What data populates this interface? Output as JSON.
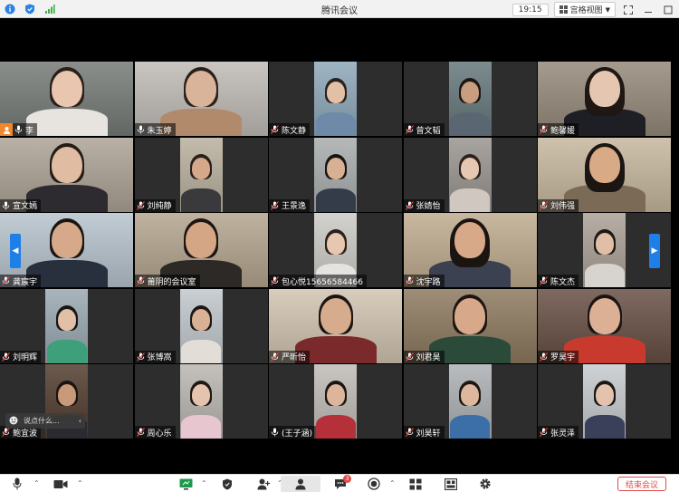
{
  "window": {
    "title": "腾讯会议",
    "time": "19:15",
    "view_mode": "宫格视图"
  },
  "participants": [
    {
      "name": "李",
      "muted": false,
      "host": true
    },
    {
      "name": "朱玉婷",
      "muted": false
    },
    {
      "name": "陈文静",
      "muted": true
    },
    {
      "name": "曾文韬",
      "muted": true
    },
    {
      "name": "鲍馨媛",
      "muted": true
    },
    {
      "name": "宣文嫣",
      "muted": false
    },
    {
      "name": "刘纯静",
      "muted": true
    },
    {
      "name": "王景逸",
      "muted": true
    },
    {
      "name": "张婧怡",
      "muted": true
    },
    {
      "name": "刘伟强",
      "muted": true
    },
    {
      "name": "龚宸宇",
      "muted": true
    },
    {
      "name": "莆阴的会议室",
      "muted": true
    },
    {
      "name": "包心悦15656584466",
      "muted": true
    },
    {
      "name": "沈宇路",
      "muted": true
    },
    {
      "name": "陈文杰",
      "muted": true
    },
    {
      "name": "刘明辉",
      "muted": true
    },
    {
      "name": "张博嵩",
      "muted": true
    },
    {
      "name": "严昕怡",
      "muted": true
    },
    {
      "name": "刘君昊",
      "muted": true
    },
    {
      "name": "罗昊宇",
      "muted": true
    },
    {
      "name": "鲍宜波",
      "muted": true
    },
    {
      "name": "周心乐",
      "muted": true
    },
    {
      "name": "(王子涵)",
      "muted": false
    },
    {
      "name": "刘昊轩",
      "muted": true
    },
    {
      "name": "张灵泽",
      "muted": true
    }
  ],
  "chat_popup": {
    "placeholder": "说点什么..."
  },
  "toolbar": {
    "end_label": "结束会议",
    "chat_badge": "3"
  },
  "colors": {
    "accent": "#1f7fe8",
    "end": "#e04848",
    "active_speaker": "#4c9a2a",
    "host": "#f0872d"
  }
}
